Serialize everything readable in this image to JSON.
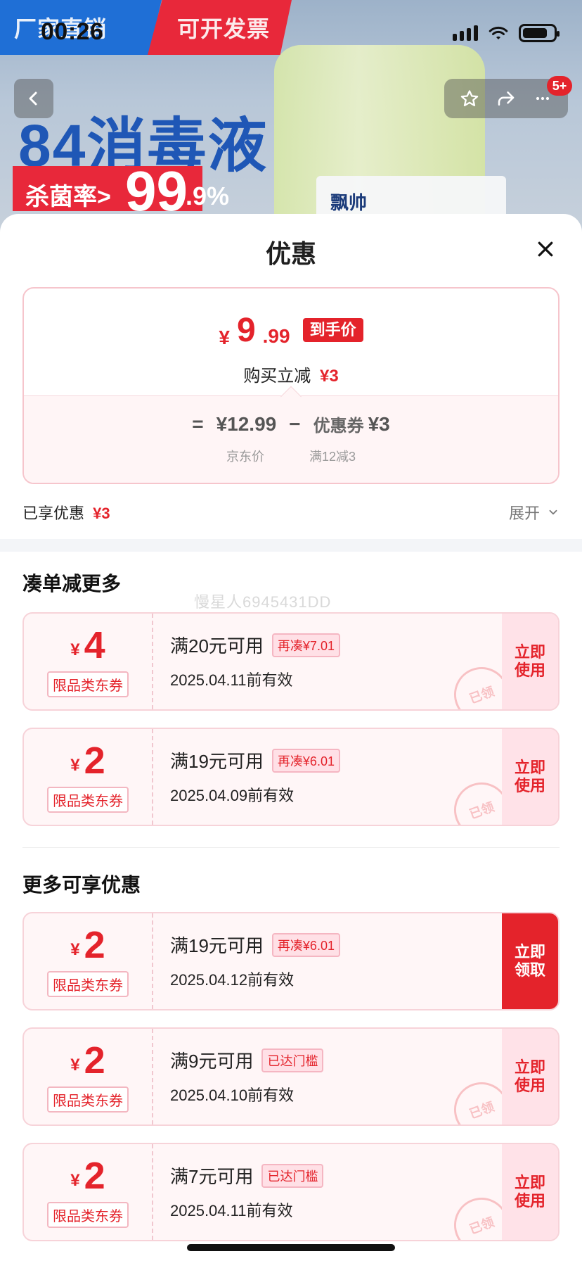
{
  "status": {
    "time": "00:26"
  },
  "banner": {
    "left_tag": "厂家直销",
    "right_tag": "可开发票",
    "product_title": "84消毒液",
    "kill_rate_label": "杀菌率>",
    "kill_rate_int": "99",
    "kill_rate_dec": ".9%",
    "brand": "飘帅",
    "notification_badge": "5+"
  },
  "sheet": {
    "title": "优惠",
    "price": {
      "currency": "¥",
      "int": "9",
      "dec": ".99",
      "tag": "到手价",
      "immediate_label": "购买立减",
      "immediate_amount": "¥3",
      "equals": "=",
      "jd_price": "¥12.99",
      "minus": "−",
      "coupon_label": "优惠券",
      "coupon_amount": "¥3",
      "jd_price_caption": "京东价",
      "coupon_caption": "满12减3"
    },
    "enjoyed": {
      "label": "已享优惠",
      "amount": "¥3",
      "expand": "展开"
    },
    "sections": {
      "more_discount_title": "凑单减更多",
      "more_available_title": "更多可享优惠"
    },
    "watermark": "慢星人6945431DD"
  },
  "coupons_more_discount": [
    {
      "yen": "¥",
      "amount": "4",
      "type": "限品类东券",
      "condition": "满20元可用",
      "pill": "再凑¥7.01",
      "expiry": "2025.04.11前有效",
      "action": "立即\n使用",
      "stamp": "已领"
    },
    {
      "yen": "¥",
      "amount": "2",
      "type": "限品类东券",
      "condition": "满19元可用",
      "pill": "再凑¥6.01",
      "expiry": "2025.04.09前有效",
      "action": "立即\n使用",
      "stamp": "已领"
    }
  ],
  "coupons_more_available": [
    {
      "yen": "¥",
      "amount": "2",
      "type": "限品类东券",
      "condition": "满19元可用",
      "pill": "再凑¥6.01",
      "expiry": "2025.04.12前有效",
      "action": "立即\n领取",
      "stamp": ""
    },
    {
      "yen": "¥",
      "amount": "2",
      "type": "限品类东券",
      "condition": "满9元可用",
      "pill": "已达门槛",
      "expiry": "2025.04.10前有效",
      "action": "立即\n使用",
      "stamp": "已领"
    },
    {
      "yen": "¥",
      "amount": "2",
      "type": "限品类东券",
      "condition": "满7元可用",
      "pill": "已达门槛",
      "expiry": "2025.04.11前有效",
      "action": "立即\n使用",
      "stamp": "已领"
    }
  ],
  "icons": {
    "back": "back-icon",
    "star": "star-icon",
    "share": "share-icon",
    "more": "more-icon",
    "close": "close-icon",
    "chevron": "chevron-down-icon"
  },
  "colors": {
    "accent": "#e4232b",
    "soft": "#fdebed",
    "border": "#f6c5cc"
  }
}
